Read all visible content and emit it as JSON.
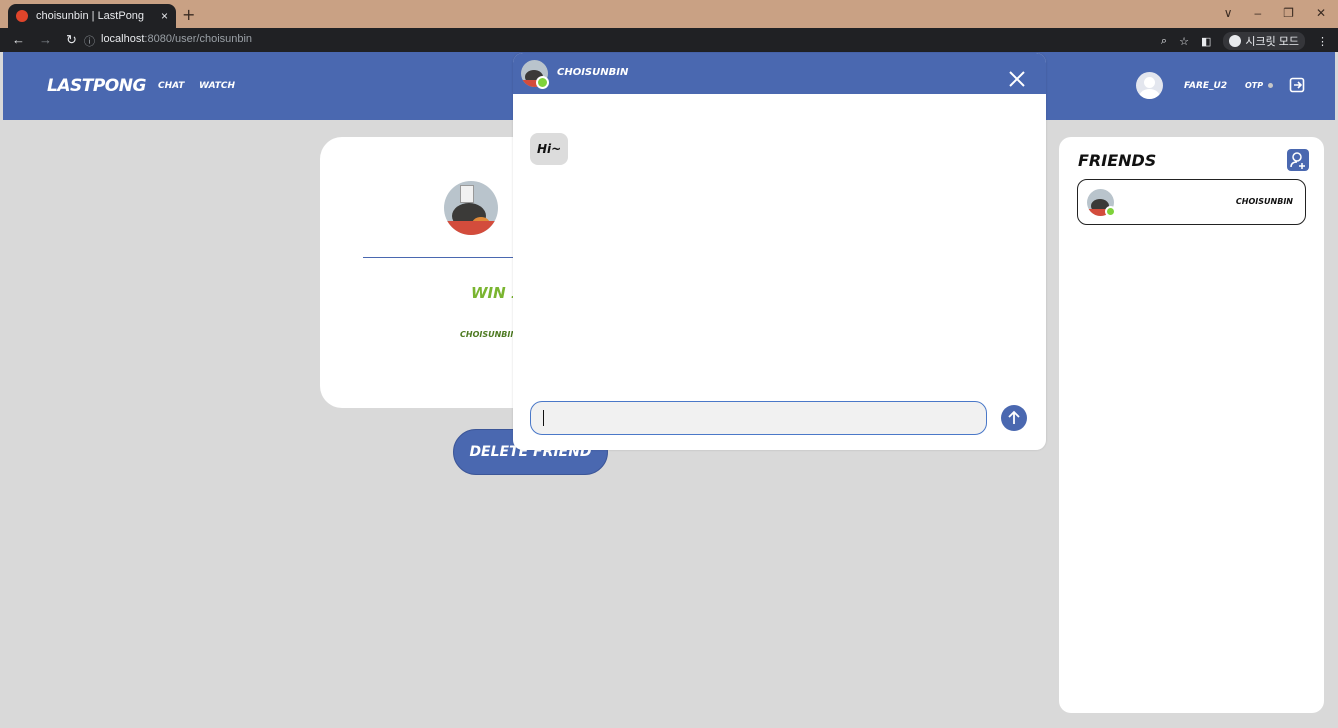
{
  "browser": {
    "tab_title": "choisunbin | LastPong",
    "tab_close": "×",
    "new_tab": "+",
    "url_host": "localhost",
    "url_path": ":8080/user/choisunbin",
    "secret_label": "시크릿 모드",
    "window_controls": [
      "∨",
      "–",
      "❐",
      "✕"
    ]
  },
  "header": {
    "brand": "LASTPONG",
    "nav": [
      "CHAT",
      "WATCH"
    ],
    "username": "FARE_U2",
    "otp_label": "OTP"
  },
  "profile": {
    "win_text": "WIN 1",
    "name": "CHOISUNBIN",
    "delete_button": "DELETE FRIEND"
  },
  "friends": {
    "title": "FRIENDS",
    "items": [
      {
        "name": "CHOISUNBIN",
        "status": "online"
      }
    ]
  },
  "chat": {
    "name": "CHOISUNBIN",
    "messages": [
      "Hi~"
    ],
    "input_value": ""
  },
  "colors": {
    "primary": "#4a68b0",
    "online": "#7ed23a",
    "win": "#7ab530",
    "background": "#d9d9d9"
  }
}
